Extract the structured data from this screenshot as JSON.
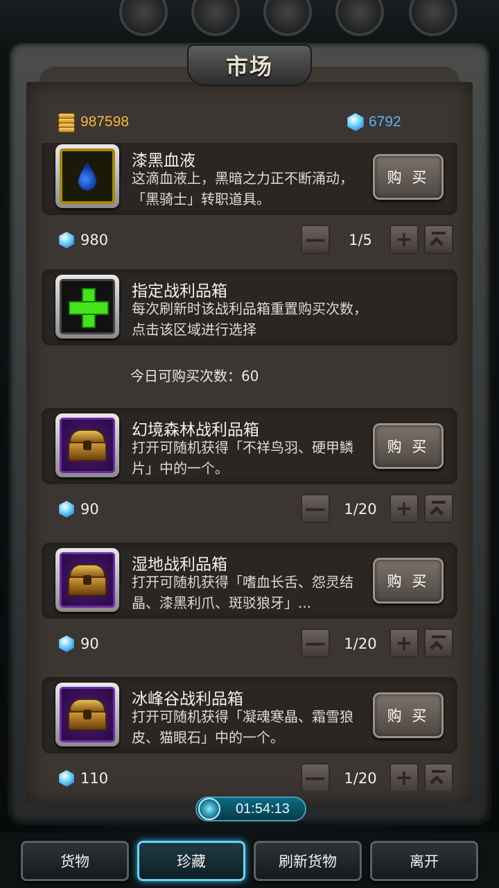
{
  "title": "市场",
  "currency": {
    "gold": "987598",
    "gems": "6792"
  },
  "buy_label": "购 买",
  "items": [
    {
      "name": "漆黑血液",
      "desc": "这滴血液上，黑暗之力正不断涌动，「黑骑士」转职道具。",
      "icon": "blood-drop-icon",
      "price": "980",
      "count": "1/5"
    },
    {
      "name": "指定战利品箱",
      "desc": "每次刷新时该战利品箱重置购买次数，点击该区域进行选择",
      "icon": "plus-icon",
      "daily_limit": "今日可购买次数：60"
    },
    {
      "name": "幻境森林战利品箱",
      "desc": "打开可随机获得「不祥鸟羽、硬甲鳞片」中的一个。",
      "icon": "chest-icon",
      "price": "90",
      "count": "1/20"
    },
    {
      "name": "湿地战利品箱",
      "desc": "打开可随机获得「嗜血长舌、怨灵结晶、漆黑利爪、斑驳狼牙」...",
      "icon": "chest-icon",
      "price": "90",
      "count": "1/20"
    },
    {
      "name": "冰峰谷战利品箱",
      "desc": "打开可随机获得「凝魂寒晶、霜雪狼皮、猫眼石」中的一个。",
      "icon": "chest-icon",
      "price": "110",
      "count": "1/20"
    }
  ],
  "timer": "01:54:13",
  "nav": [
    "货物",
    "珍藏",
    "刷新货物",
    "离开"
  ],
  "nav_active_index": 1
}
